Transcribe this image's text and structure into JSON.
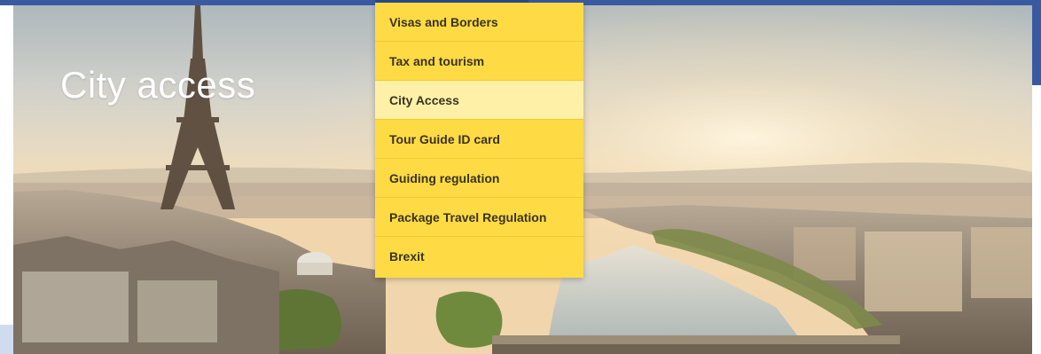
{
  "hero": {
    "title": "City access"
  },
  "menu": {
    "items": [
      {
        "label": "Visas and Borders",
        "active": false
      },
      {
        "label": "Tax and tourism",
        "active": false
      },
      {
        "label": "City Access",
        "active": true
      },
      {
        "label": "Tour Guide ID card",
        "active": false
      },
      {
        "label": "Guiding regulation",
        "active": false
      },
      {
        "label": "Package Travel Regulation",
        "active": false
      },
      {
        "label": "Brexit",
        "active": false
      }
    ]
  },
  "colors": {
    "nav_blue": "#3a5aa0",
    "menu_yellow": "#fedb44",
    "menu_active": "#fff0a8",
    "title_text": "#ffffff"
  }
}
